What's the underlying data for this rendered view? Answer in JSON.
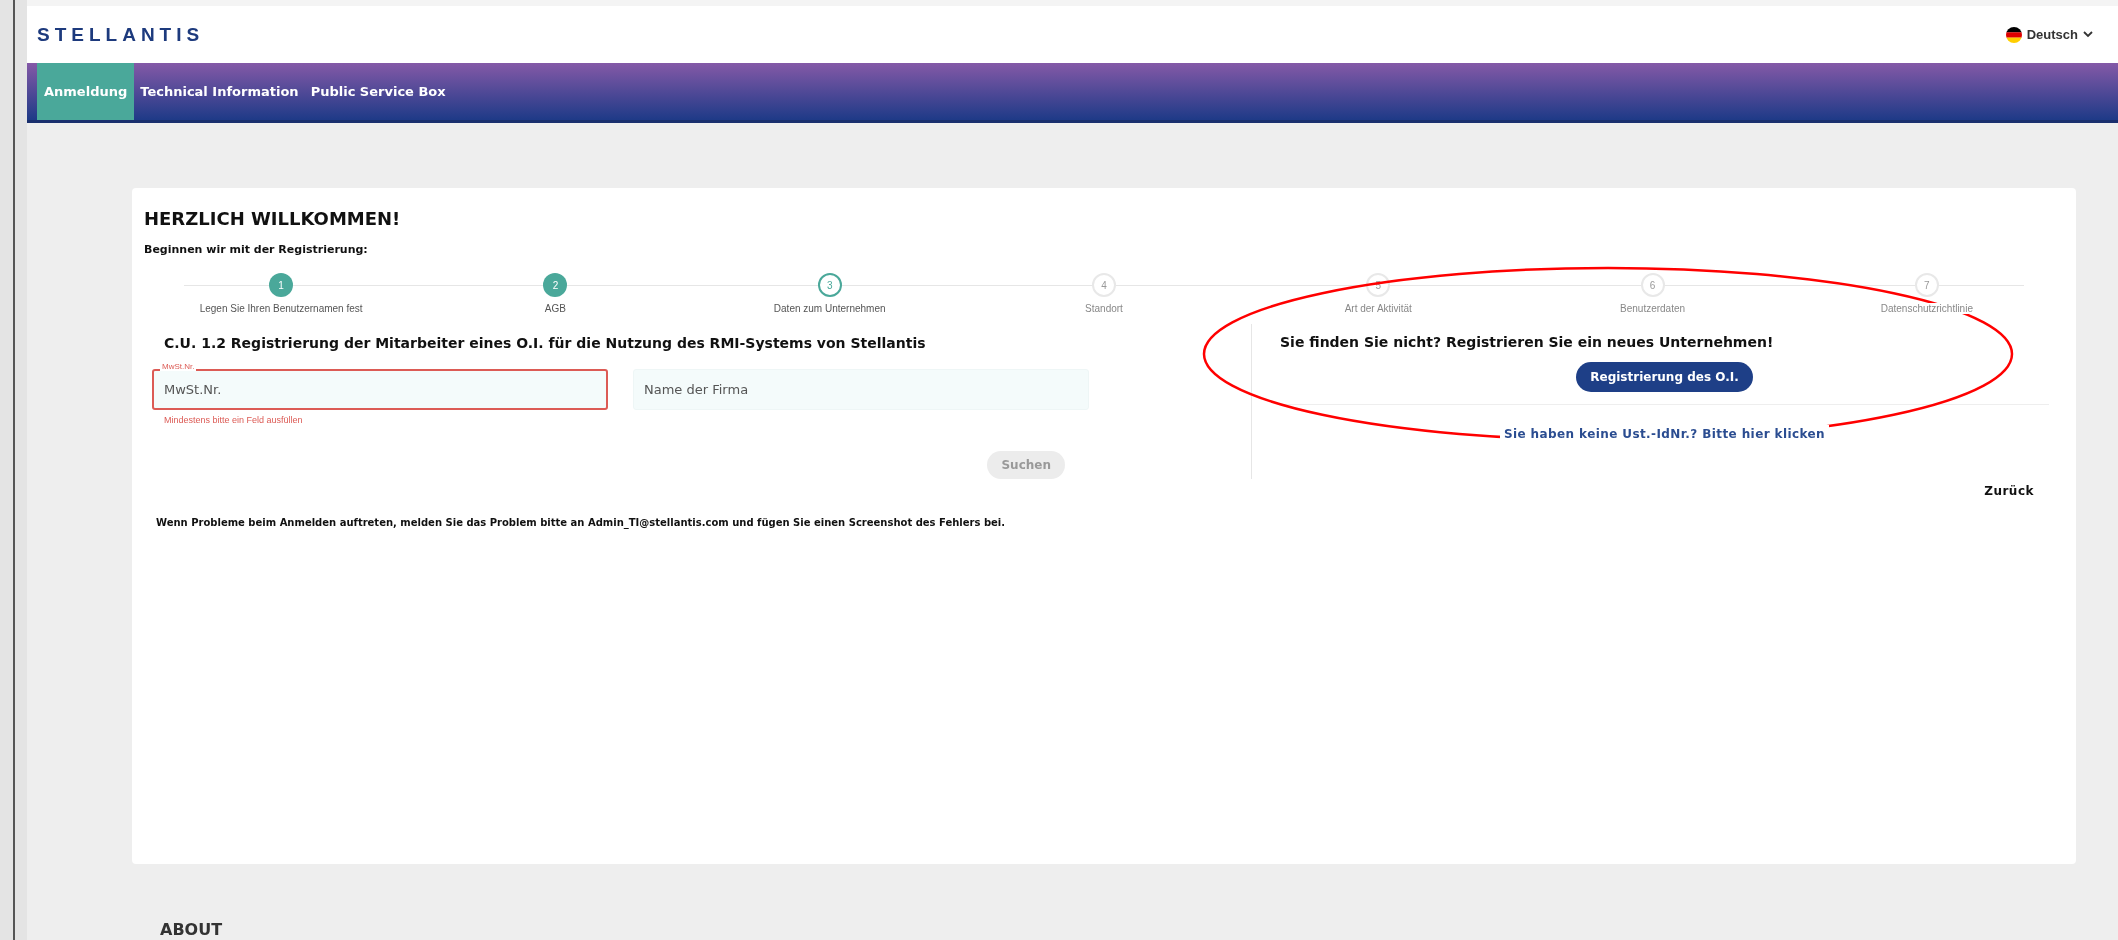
{
  "header": {
    "logo": "STELLANTIS",
    "language": "Deutsch"
  },
  "nav": [
    {
      "label": "Anmeldung",
      "selected": true
    },
    {
      "label": "Technical Information",
      "selected": false
    },
    {
      "label": "Public Service Box",
      "selected": false
    }
  ],
  "welcome": {
    "title": "HERZLICH WILLKOMMEN!",
    "subtitle": "Beginnen wir mit der Registrierung:"
  },
  "steps": [
    {
      "number": "1",
      "label": "Legen Sie Ihren Benutzernamen fest",
      "completed": true,
      "selected": false
    },
    {
      "number": "2",
      "label": "AGB",
      "completed": true,
      "selected": false
    },
    {
      "number": "3",
      "label": "Daten zum Unternehmen",
      "completed": false,
      "selected": true
    },
    {
      "number": "4",
      "label": "Standort",
      "completed": false,
      "selected": false
    },
    {
      "number": "5",
      "label": "Art der Aktivität",
      "completed": false,
      "selected": false
    },
    {
      "number": "6",
      "label": "Benutzerdaten",
      "completed": false,
      "selected": false
    },
    {
      "number": "7",
      "label": "Datenschutzrichtlinie",
      "completed": false,
      "selected": false
    }
  ],
  "search_panel": {
    "title": "C.U. 1.2 Registrierung der Mitarbeiter eines O.I. für die Nutzung des RMI-Systems von Stellantis",
    "fields": [
      {
        "label": "MwSt.Nr.",
        "placeholder": "MwSt.Nr.",
        "invalid": true,
        "error": "Mindestens bitte ein Feld ausfüllen"
      },
      {
        "placeholder": "Name der Firma",
        "invalid": false
      }
    ],
    "button": {
      "label": "Suchen",
      "disabled": true
    }
  },
  "register_panel": {
    "title": "Sie finden Sie nicht? Registrieren Sie ein neues Unternehmen!",
    "button": "Registrierung des O.I.",
    "link": "Sie haben keine Ust.-IdNr.? Bitte hier klicken"
  },
  "back": "Zurück",
  "notice": "Wenn Probleme beim Anmelden auftreten, melden Sie das Problem bitte an Admin_TI@stellantis.com und fügen Sie einen Screenshot des Fehlers bei.",
  "footer_heading": "ABOUT",
  "annotation": {
    "kind": "ellipse"
  }
}
